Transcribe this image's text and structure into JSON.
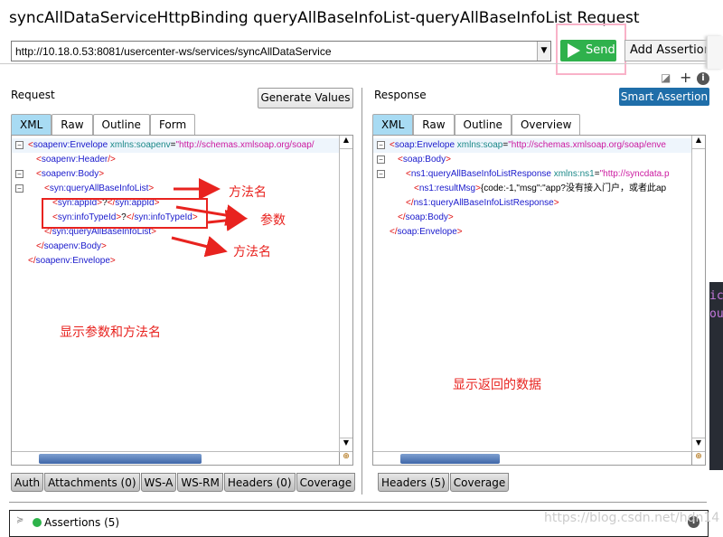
{
  "window": {
    "title": "syncAllDataServiceHttpBinding queryAllBaseInfoList-queryAllBaseInfoList Request"
  },
  "toolbar": {
    "url": "http://10.18.0.53:8081/usercenter-ws/services/syncAllDataService",
    "send_label": "Send",
    "add_assertion_label": "Add Assertion",
    "send_color": "#2fb14c"
  },
  "request": {
    "label": "Request",
    "generate_values_label": "Generate Values",
    "tabs": [
      "XML",
      "Raw",
      "Outline",
      "Form"
    ],
    "xml_lines": [
      {
        "fold": true,
        "indent": 0,
        "parts": [
          [
            "t",
            "<"
          ],
          [
            "n",
            "soapenv:Envelope"
          ],
          [
            "a",
            " xmlns:soapenv"
          ],
          [
            "x",
            "="
          ],
          [
            "v",
            "\"http://schemas.xmlsoap.org/soap/"
          ]
        ]
      },
      {
        "fold": false,
        "indent": 1,
        "parts": [
          [
            "t",
            "<"
          ],
          [
            "n",
            "soapenv:Header"
          ],
          [
            "t",
            "/>"
          ]
        ]
      },
      {
        "fold": true,
        "indent": 1,
        "parts": [
          [
            "t",
            "<"
          ],
          [
            "n",
            "soapenv:Body"
          ],
          [
            "t",
            ">"
          ]
        ]
      },
      {
        "fold": true,
        "indent": 2,
        "parts": [
          [
            "t",
            "<"
          ],
          [
            "n",
            "syn:queryAllBaseInfoList"
          ],
          [
            "t",
            ">"
          ]
        ]
      },
      {
        "fold": false,
        "indent": 3,
        "parts": [
          [
            "t",
            "<"
          ],
          [
            "n",
            "syn:appId"
          ],
          [
            "t",
            ">"
          ],
          [
            "x",
            "?"
          ],
          [
            "t",
            "</"
          ],
          [
            "n",
            "syn:appId"
          ],
          [
            "t",
            ">"
          ]
        ]
      },
      {
        "fold": false,
        "indent": 3,
        "parts": [
          [
            "t",
            "<"
          ],
          [
            "n",
            "syn:infoTypeId"
          ],
          [
            "t",
            ">"
          ],
          [
            "x",
            "?"
          ],
          [
            "t",
            "</"
          ],
          [
            "n",
            "syn:infoTypeId"
          ],
          [
            "t",
            ">"
          ]
        ]
      },
      {
        "fold": false,
        "indent": 2,
        "parts": [
          [
            "t",
            "</"
          ],
          [
            "n",
            "syn:queryAllBaseInfoList"
          ],
          [
            "t",
            ">"
          ]
        ]
      },
      {
        "fold": false,
        "indent": 1,
        "parts": [
          [
            "t",
            "</"
          ],
          [
            "n",
            "soapenv:Body"
          ],
          [
            "t",
            ">"
          ]
        ]
      },
      {
        "fold": false,
        "indent": 0,
        "parts": [
          [
            "t",
            "</"
          ],
          [
            "n",
            "soapenv:Envelope"
          ],
          [
            "t",
            ">"
          ]
        ]
      }
    ],
    "bottom_tabs": [
      "Auth",
      "Attachments (0)",
      "WS-A",
      "WS-RM",
      "Headers (0)",
      "Coverage"
    ]
  },
  "response": {
    "label": "Response",
    "smart_assertion_label": "Smart Assertion",
    "tabs": [
      "XML",
      "Raw",
      "Outline",
      "Overview"
    ],
    "xml_lines": [
      {
        "fold": true,
        "indent": 0,
        "parts": [
          [
            "t",
            "<"
          ],
          [
            "n",
            "soap:Envelope"
          ],
          [
            "a",
            " xmlns:soap"
          ],
          [
            "x",
            "="
          ],
          [
            "v",
            "\"http://schemas.xmlsoap.org/soap/enve"
          ]
        ]
      },
      {
        "fold": true,
        "indent": 1,
        "parts": [
          [
            "t",
            "<"
          ],
          [
            "n",
            "soap:Body"
          ],
          [
            "t",
            ">"
          ]
        ]
      },
      {
        "fold": true,
        "indent": 2,
        "parts": [
          [
            "t",
            "<"
          ],
          [
            "n",
            "ns1:queryAllBaseInfoListResponse"
          ],
          [
            "a",
            " xmlns:ns1"
          ],
          [
            "x",
            "="
          ],
          [
            "v",
            "\"http://syncdata.p"
          ]
        ]
      },
      {
        "fold": false,
        "indent": 3,
        "parts": [
          [
            "t",
            "<"
          ],
          [
            "n",
            "ns1:resultMsg"
          ],
          [
            "t",
            ">"
          ],
          [
            "x",
            "{code:-1,\"msg\":\"app?没有接入门户，或者此ap"
          ]
        ]
      },
      {
        "fold": false,
        "indent": 2,
        "parts": [
          [
            "t",
            "</"
          ],
          [
            "n",
            "ns1:queryAllBaseInfoListResponse"
          ],
          [
            "t",
            ">"
          ]
        ]
      },
      {
        "fold": false,
        "indent": 1,
        "parts": [
          [
            "t",
            "</"
          ],
          [
            "n",
            "soap:Body"
          ],
          [
            "t",
            ">"
          ]
        ]
      },
      {
        "fold": false,
        "indent": 0,
        "parts": [
          [
            "t",
            "</"
          ],
          [
            "n",
            "soap:Envelope"
          ],
          [
            "t",
            ">"
          ]
        ]
      }
    ],
    "bottom_tabs": [
      "Headers (5)",
      "Coverage"
    ]
  },
  "annotations": {
    "method_name_1": "方法名",
    "params": "参数",
    "method_name_2": "方法名",
    "show_params": "显示参数和方法名",
    "show_return": "显示返回的数据",
    "color": "#e8231f"
  },
  "assertions": {
    "label": "Assertions (5)",
    "status_color": "#2db34a"
  },
  "side_panel": {
    "line1": "ic",
    "line2": "ou"
  },
  "watermark": "https://blog.csdn.net/hdn14"
}
